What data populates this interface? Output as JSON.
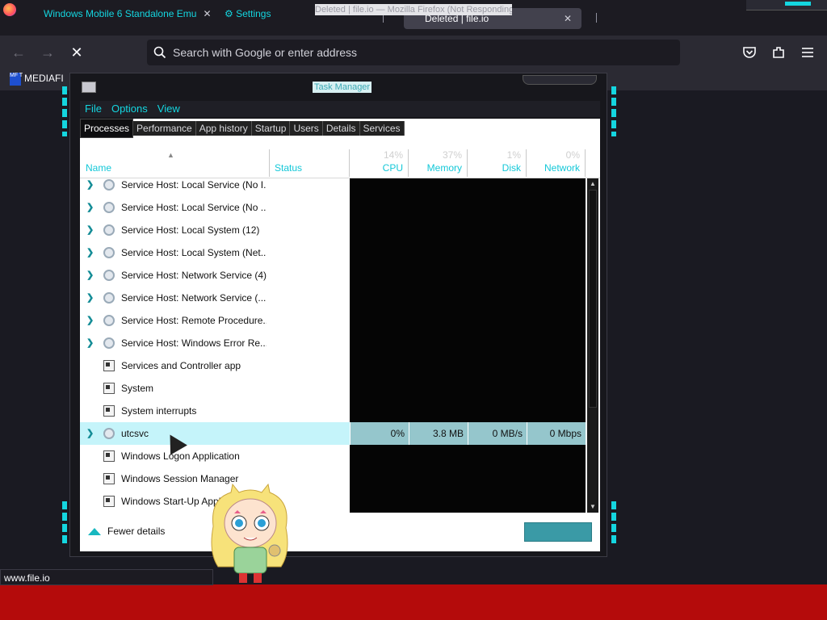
{
  "browser": {
    "window_title": "Deleted | file.io — Mozilla Firefox (Not Responding)",
    "tabs": [
      {
        "label": "Windows Mobile 6 Standalone Emu",
        "close": "✕"
      },
      {
        "label": "Settings",
        "close": "✕"
      },
      {
        "label": "Deleted | file.io",
        "close": "✕"
      }
    ],
    "url_placeholder": "Search with Google or enter address",
    "bookmark": {
      "label": "MEDIAFI",
      "logo": "MF T"
    },
    "status_url": "www.file.io"
  },
  "taskmgr": {
    "title": "Task Manager",
    "menu": [
      "File",
      "Options",
      "View"
    ],
    "tabs": [
      "Processes",
      "Performance",
      "App history",
      "Startup",
      "Users",
      "Details",
      "Services"
    ],
    "columns": {
      "name": "Name",
      "status": "Status",
      "cpu": {
        "pct": "14%",
        "label": "CPU"
      },
      "memory": {
        "pct": "37%",
        "label": "Memory"
      },
      "disk": {
        "pct": "1%",
        "label": "Disk"
      },
      "network": {
        "pct": "0%",
        "label": "Network"
      }
    },
    "processes": [
      {
        "name": "Service Host: Local Service (No I...",
        "icon": "gear-icon"
      },
      {
        "name": "Service Host: Local Service (No ...",
        "icon": "gear-icon"
      },
      {
        "name": "Service Host: Local System (12)",
        "icon": "gear-icon"
      },
      {
        "name": "Service Host: Local System (Net...",
        "icon": "gear-icon"
      },
      {
        "name": "Service Host: Network Service (4)",
        "icon": "gear-icon"
      },
      {
        "name": "Service Host: Network Service (...",
        "icon": "gear-icon"
      },
      {
        "name": "Service Host: Remote Procedure...",
        "icon": "gear-icon"
      },
      {
        "name": "Service Host: Windows Error Re...",
        "icon": "gear-icon"
      },
      {
        "name": "Services and Controller app",
        "icon": "window-icon"
      },
      {
        "name": "System",
        "icon": "window-icon"
      },
      {
        "name": "System interrupts",
        "icon": "window-icon"
      },
      {
        "name": "utcsvc",
        "icon": "gear-icon",
        "cpu": "0%",
        "memory": "3.8 MB",
        "disk": "0 MB/s",
        "network": "0 Mbps"
      },
      {
        "name": "Windows Logon Application",
        "icon": "window-icon"
      },
      {
        "name": "Windows Session Manager",
        "icon": "window-icon"
      },
      {
        "name": "Windows Start-Up Appli",
        "icon": "window-icon"
      }
    ],
    "fewer_details": "Fewer details"
  },
  "colors": {
    "accent": "#14d6e0",
    "selected_row": "#c5f4fa",
    "footer": "#b40b0b"
  }
}
